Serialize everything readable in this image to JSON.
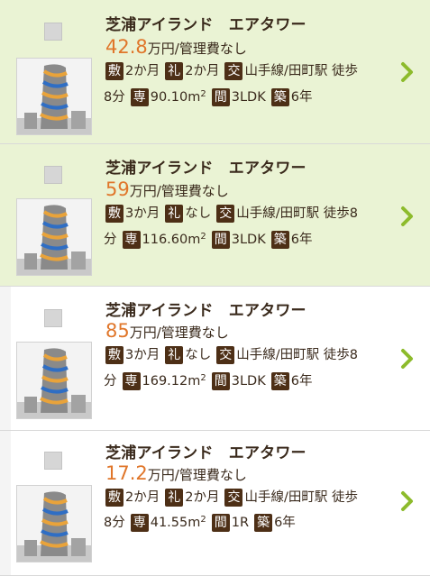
{
  "listings": [
    {
      "name": "芝浦アイランド　エアタワー",
      "price": "42.8",
      "price_unit": "万円/管理費なし",
      "shiki_icon": "敷",
      "shiki": "2か月",
      "rei_icon": "礼",
      "rei": "2か月",
      "kou_icon": "交",
      "access_1": "山手線/田町駅 徒歩",
      "access_2": "8分",
      "sen_icon": "専",
      "area": "90.10m",
      "area_sup": "2",
      "ma_icon": "間",
      "layout": "3LDK",
      "chiku_icon": "築",
      "age": "6年",
      "highlighted": true
    },
    {
      "name": "芝浦アイランド　エアタワー",
      "price": "59",
      "price_unit": "万円/管理費なし",
      "shiki_icon": "敷",
      "shiki": "3か月",
      "rei_icon": "礼",
      "rei": "なし",
      "kou_icon": "交",
      "access_1": "山手線/田町駅 徒歩8",
      "access_2": "分",
      "sen_icon": "専",
      "area": "116.60m",
      "area_sup": "2",
      "ma_icon": "間",
      "layout": "3LDK",
      "chiku_icon": "築",
      "age": "6年",
      "highlighted": true
    },
    {
      "name": "芝浦アイランド　エアタワー",
      "price": "85",
      "price_unit": "万円/管理費なし",
      "shiki_icon": "敷",
      "shiki": "3か月",
      "rei_icon": "礼",
      "rei": "なし",
      "kou_icon": "交",
      "access_1": "山手線/田町駅 徒歩8",
      "access_2": "分",
      "sen_icon": "専",
      "area": "169.12m",
      "area_sup": "2",
      "ma_icon": "間",
      "layout": "3LDK",
      "chiku_icon": "築",
      "age": "6年",
      "highlighted": false
    },
    {
      "name": "芝浦アイランド　エアタワー",
      "price": "17.2",
      "price_unit": "万円/管理費なし",
      "shiki_icon": "敷",
      "shiki": "2か月",
      "rei_icon": "礼",
      "rei": "2か月",
      "kou_icon": "交",
      "access_1": "山手線/田町駅 徒歩",
      "access_2": "8分",
      "sen_icon": "専",
      "area": "41.55m",
      "area_sup": "2",
      "ma_icon": "間",
      "layout": "1R",
      "chiku_icon": "築",
      "age": "6年",
      "highlighted": false
    }
  ],
  "colors": {
    "price": "#e0762a",
    "badge": "#4d2f16",
    "highlight_bg": "#eaf3d4",
    "chevron": "#8dbb2c"
  },
  "icons": {
    "chevron": "chevron-right-icon",
    "thumbnail": "building-photo"
  }
}
